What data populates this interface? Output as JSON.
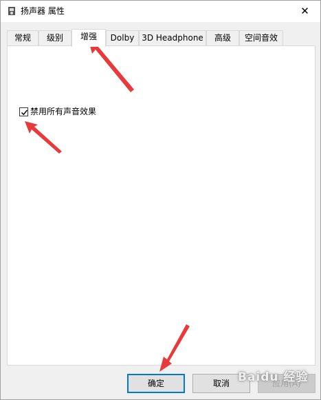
{
  "window": {
    "title": "扬声器 属性",
    "close_glyph": "✕"
  },
  "tabs": [
    {
      "label": "常规",
      "active": false
    },
    {
      "label": "级别",
      "active": false
    },
    {
      "label": "增强",
      "active": true
    },
    {
      "label": "Dolby",
      "active": false
    },
    {
      "label": "3D Headphone",
      "active": false
    },
    {
      "label": "高级",
      "active": false
    },
    {
      "label": "空间音效",
      "active": false
    }
  ],
  "enhancements": {
    "disable_all_label": "禁用所有声音效果",
    "disable_all_checked": true
  },
  "buttons": {
    "ok_label": "确定",
    "cancel_label": "取消",
    "apply_label": "应用(A)"
  },
  "annotation_color": "#e83a3a",
  "watermark_text": "Baidu 经验"
}
